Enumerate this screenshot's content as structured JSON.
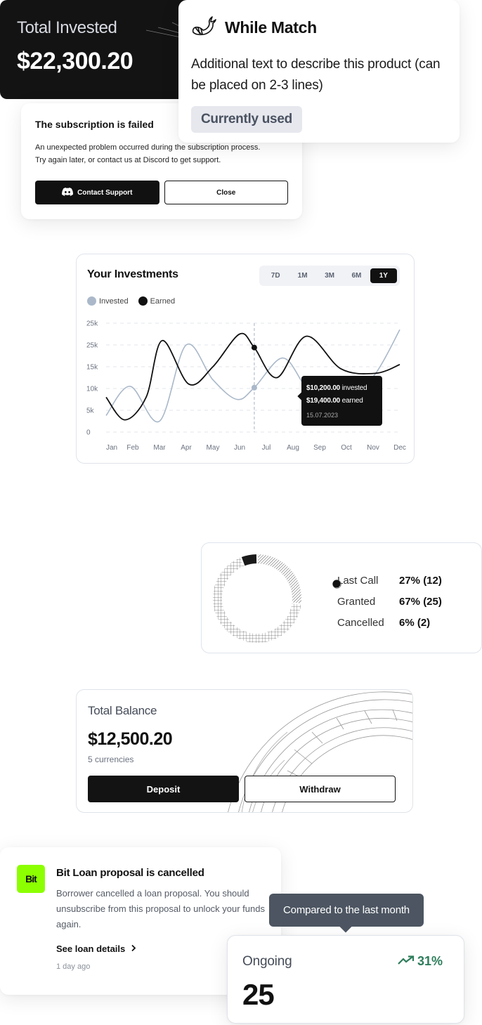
{
  "product": {
    "icon": "whale-icon",
    "title": "While Match",
    "description": "Additional text to describe this product (can be placed on 2-3 lines)",
    "badge": "Currently used"
  },
  "subscription": {
    "title": "The subscription is failed",
    "message_line1": "An unexpected problem occurred during the subscription process.",
    "message_line2": "Try again later, or contact us at Discord to get support.",
    "contact_label": "Contact Support",
    "contact_icon": "discord-icon",
    "close_label": "Close"
  },
  "investments": {
    "title": "Your Investments",
    "ranges": [
      {
        "label": "7D",
        "active": false
      },
      {
        "label": "1M",
        "active": false
      },
      {
        "label": "3M",
        "active": false
      },
      {
        "label": "6M",
        "active": false
      },
      {
        "label": "1Y",
        "active": true
      }
    ],
    "tooltip": {
      "invested_value": "$10,200.00",
      "invested_label": "invested",
      "earned_value": "$19,400.00",
      "earned_label": "earned",
      "date": "15.07.2023"
    }
  },
  "chart_data": {
    "type": "line",
    "title": "Your Investments",
    "xlabel": "",
    "ylabel": "",
    "categories": [
      "Jan",
      "Feb",
      "Mar",
      "Apr",
      "May",
      "Jun",
      "Jul",
      "Aug",
      "Sep",
      "Oct",
      "Nov",
      "Dec"
    ],
    "y_ticks": [
      "0",
      "5k",
      "10k",
      "15k",
      "25k",
      "25k"
    ],
    "ylim": [
      0,
      25000
    ],
    "grid": true,
    "legend_position": "top-left",
    "series": [
      {
        "name": "Invested",
        "color": "#aab8c9",
        "points": [
          [
            0,
            3800
          ],
          [
            0.9,
            10500
          ],
          [
            2,
            2500
          ],
          [
            3,
            20000
          ],
          [
            4,
            12000
          ],
          [
            4.9,
            7500
          ],
          [
            5.55,
            10200
          ],
          [
            6.6,
            17000
          ],
          [
            7.4,
            11000
          ],
          [
            8.1,
            5000
          ],
          [
            9.0,
            6500
          ],
          [
            10.1,
            13500
          ],
          [
            11,
            23500
          ]
        ]
      },
      {
        "name": "Earned",
        "color": "#111111",
        "points": [
          [
            0,
            8000
          ],
          [
            0.7,
            2800
          ],
          [
            1.5,
            8000
          ],
          [
            2.1,
            21000
          ],
          [
            3.1,
            11000
          ],
          [
            4,
            15000
          ],
          [
            5,
            22500
          ],
          [
            5.55,
            19400
          ],
          [
            6.4,
            12500
          ],
          [
            7.5,
            22000
          ],
          [
            8.8,
            14500
          ],
          [
            10.1,
            13500
          ],
          [
            11,
            15500
          ]
        ]
      }
    ],
    "highlight": {
      "x": 5.55,
      "invested": 10200,
      "earned": 19400,
      "date": "15.07.2023"
    }
  },
  "total_invested": {
    "label": "Total Invested",
    "value": "$22,300.20"
  },
  "distribution": {
    "items": [
      {
        "name": "Last Call",
        "value": "27% (12)",
        "percent": 27,
        "icon": "hatched-icon"
      },
      {
        "name": "Granted",
        "value": "67% (25)",
        "percent": 67,
        "icon": "grid-icon"
      },
      {
        "name": "Cancelled",
        "value": "6% (2)",
        "percent": 6,
        "icon": "solid-dot-icon"
      }
    ]
  },
  "balance": {
    "label": "Total Balance",
    "value": "$12,500.20",
    "sub": "5 currencies",
    "deposit_label": "Deposit",
    "withdraw_label": "Withdraw"
  },
  "loan": {
    "logo": "Bit",
    "title": "Bit Loan proposal is cancelled",
    "message": "Borrower cancelled a loan proposal. You should unsubscribe from this proposal to unlock your funds again.",
    "link": "See loan details",
    "time": "1 day ago"
  },
  "ongoing": {
    "tooltip": "Compared to the last month",
    "label": "Ongoing",
    "value": "25",
    "trend": "31%",
    "trend_color": "#2e7d5b"
  }
}
